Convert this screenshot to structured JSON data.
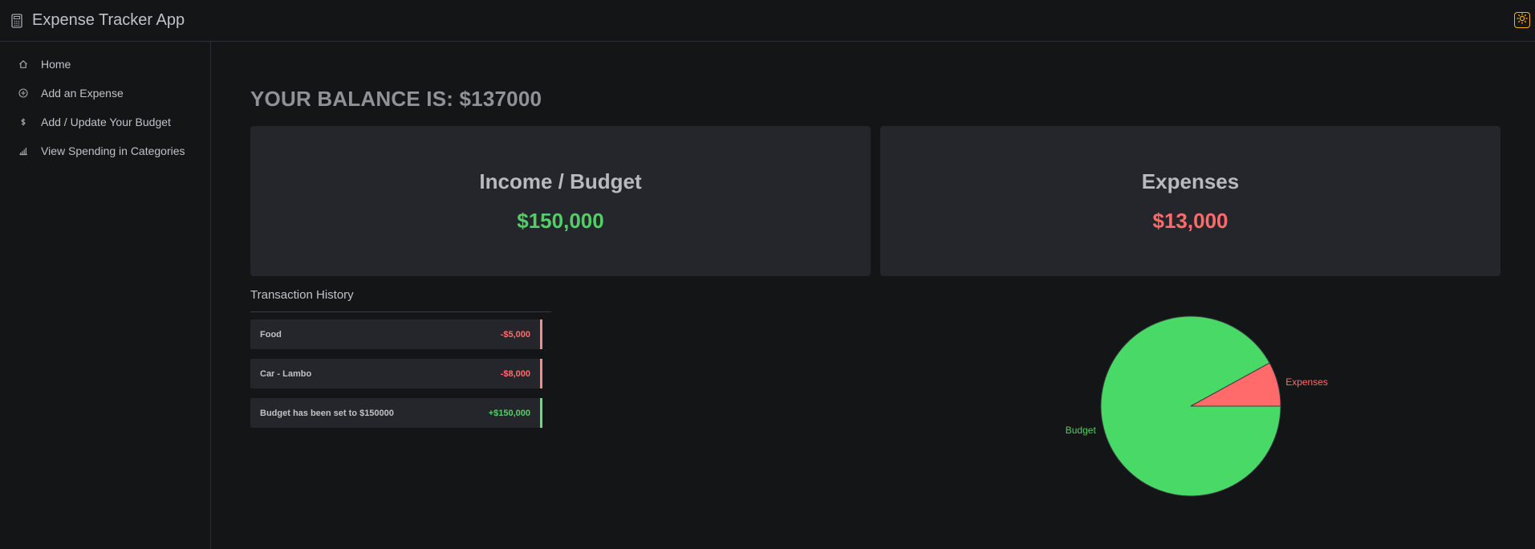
{
  "app": {
    "title": "Expense Tracker App"
  },
  "sidebar": {
    "items": [
      {
        "label": "Home",
        "icon": "home-icon"
      },
      {
        "label": "Add an Expense",
        "icon": "plus-circle-icon"
      },
      {
        "label": "Add / Update Your Budget",
        "icon": "dollar-icon"
      },
      {
        "label": "View Spending in Categories",
        "icon": "bar-chart-icon"
      }
    ]
  },
  "balance": {
    "text": "YOUR BALANCE IS: $137000"
  },
  "cards": {
    "income": {
      "title": "Income / Budget",
      "value": "$150,000"
    },
    "expenses": {
      "title": "Expenses",
      "value": "$13,000"
    }
  },
  "history": {
    "title": "Transaction History",
    "items": [
      {
        "name": "Food",
        "amount": "-$5,000",
        "type": "expense"
      },
      {
        "name": "Car - Lambo",
        "amount": "-$8,000",
        "type": "expense"
      },
      {
        "name": "Budget has been set to $150000",
        "amount": "+$150,000",
        "type": "income"
      }
    ]
  },
  "colors": {
    "income": "#51cf66",
    "expense": "#ff6b6b",
    "pie_budget": "#48d966",
    "pie_expenses": "#ff6b6b",
    "accent_toggle": "#fab005"
  },
  "chart_data": {
    "type": "pie",
    "categories": [
      "Budget",
      "Expenses"
    ],
    "values": [
      150000,
      13000
    ],
    "labels": [
      "Budget",
      "Expenses"
    ]
  }
}
